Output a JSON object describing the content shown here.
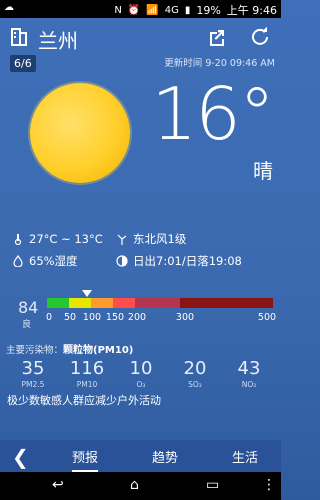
{
  "status_bar": {
    "left_icon": "weather-notification-icon",
    "battery": "19%",
    "time_label": "上午 9:46",
    "network": "4G"
  },
  "header": {
    "city": "兰州",
    "share_icon": "share-icon",
    "refresh_icon": "refresh-icon"
  },
  "page": {
    "indicator": "6/6"
  },
  "update": {
    "label": "更新时间 9-20 09:46 AM"
  },
  "current": {
    "temperature": "16°",
    "condition": "晴"
  },
  "details": {
    "temp_range": "27°C ~ 13°C",
    "wind": "东北风1级",
    "humidity": "65%湿度",
    "sun_times": "日出7:01/日落19:08"
  },
  "aqi": {
    "value": "84",
    "level": "良",
    "ticks": [
      "0",
      "50",
      "100",
      "150",
      "200",
      "300",
      "500"
    ],
    "bar_colors": [
      "#26c62f",
      "#e6e600",
      "#ff9a2e",
      "#ff4d4d",
      "#b3354e",
      "#8a1414"
    ]
  },
  "pollutant": {
    "label": "主要污染物：",
    "primary": "颗粒物(PM10)"
  },
  "metrics": [
    {
      "value": "35",
      "label": "PM2.5"
    },
    {
      "value": "116",
      "label": "PM10"
    },
    {
      "value": "10",
      "label": "O₃"
    },
    {
      "value": "20",
      "label": "SO₂"
    },
    {
      "value": "43",
      "label": "NO₂"
    }
  ],
  "advice": "极少数敏感人群应减少户外活动",
  "tabs": [
    {
      "label": "预报",
      "active": true
    },
    {
      "label": "趋势",
      "active": false
    },
    {
      "label": "生活",
      "active": false
    }
  ],
  "navbar": {
    "back_icon": "back-icon",
    "home_icon": "home-icon",
    "recents_icon": "recents-icon",
    "menu_icon": "menu-icon"
  }
}
